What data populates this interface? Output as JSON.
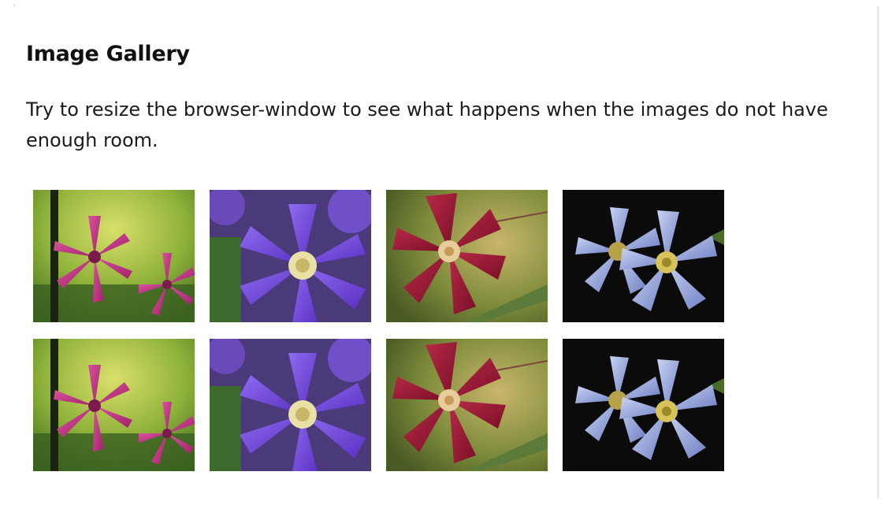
{
  "page": {
    "title": "Image Gallery",
    "description": "Try to resize the browser-window to see what happens when the images do not have enough room."
  },
  "gallery": {
    "rows": [
      [
        {
          "image": "pink-clematis-flower"
        },
        {
          "image": "purple-clematis-flower"
        },
        {
          "image": "red-clematis-flower"
        },
        {
          "image": "blue-clematis-flower"
        }
      ],
      [
        {
          "image": "pink-clematis-flower"
        },
        {
          "image": "purple-clematis-flower"
        },
        {
          "image": "red-clematis-flower"
        },
        {
          "image": "blue-clematis-flower"
        }
      ]
    ]
  }
}
